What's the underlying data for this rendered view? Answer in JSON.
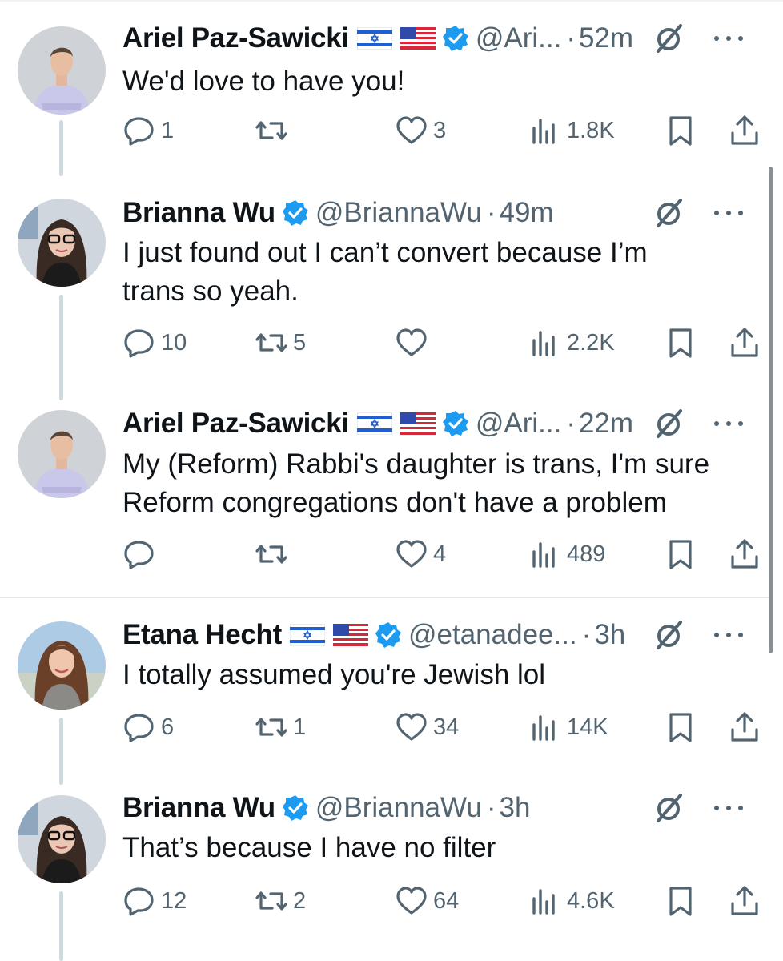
{
  "colors": {
    "text_primary": "#0f1419",
    "text_secondary": "#536471",
    "verified_blue": "#1d9bf0",
    "thread_line": "#cfd9de"
  },
  "tweets": [
    {
      "name": "Ariel Paz-Sawicki",
      "flags": [
        "israel-flag",
        "us-flag"
      ],
      "handle": "@Ari...",
      "separator": "·",
      "time": "52m",
      "text": "We'd love to have you!",
      "replies": "1",
      "retweets": "",
      "likes": "3",
      "views": "1.8K"
    },
    {
      "name": "Brianna Wu",
      "flags": [],
      "handle": "@BriannaWu",
      "separator": "·",
      "time": "49m",
      "text": "I just found out I can’t convert because I’m trans so yeah.",
      "replies": "10",
      "retweets": "5",
      "likes": "",
      "views": "2.2K"
    },
    {
      "name": "Ariel Paz-Sawicki",
      "flags": [
        "israel-flag",
        "us-flag"
      ],
      "handle": "@Ari...",
      "separator": "·",
      "time": "22m",
      "text": "My (Reform) Rabbi's daughter is trans, I'm sure Reform congregations don't have a problem",
      "replies": "",
      "retweets": "",
      "likes": "4",
      "views": "489"
    },
    {
      "name": "Etana Hecht",
      "flags": [
        "israel-flag",
        "us-flag"
      ],
      "handle": "@etanadee...",
      "separator": "·",
      "time": "3h",
      "text": "I totally assumed you're Jewish lol",
      "replies": "6",
      "retweets": "1",
      "likes": "34",
      "views": "14K"
    },
    {
      "name": "Brianna Wu",
      "flags": [],
      "handle": "@BriannaWu",
      "separator": "·",
      "time": "3h",
      "text": "That’s because I have no filter",
      "replies": "12",
      "retweets": "2",
      "likes": "64",
      "views": "4.6K"
    }
  ]
}
